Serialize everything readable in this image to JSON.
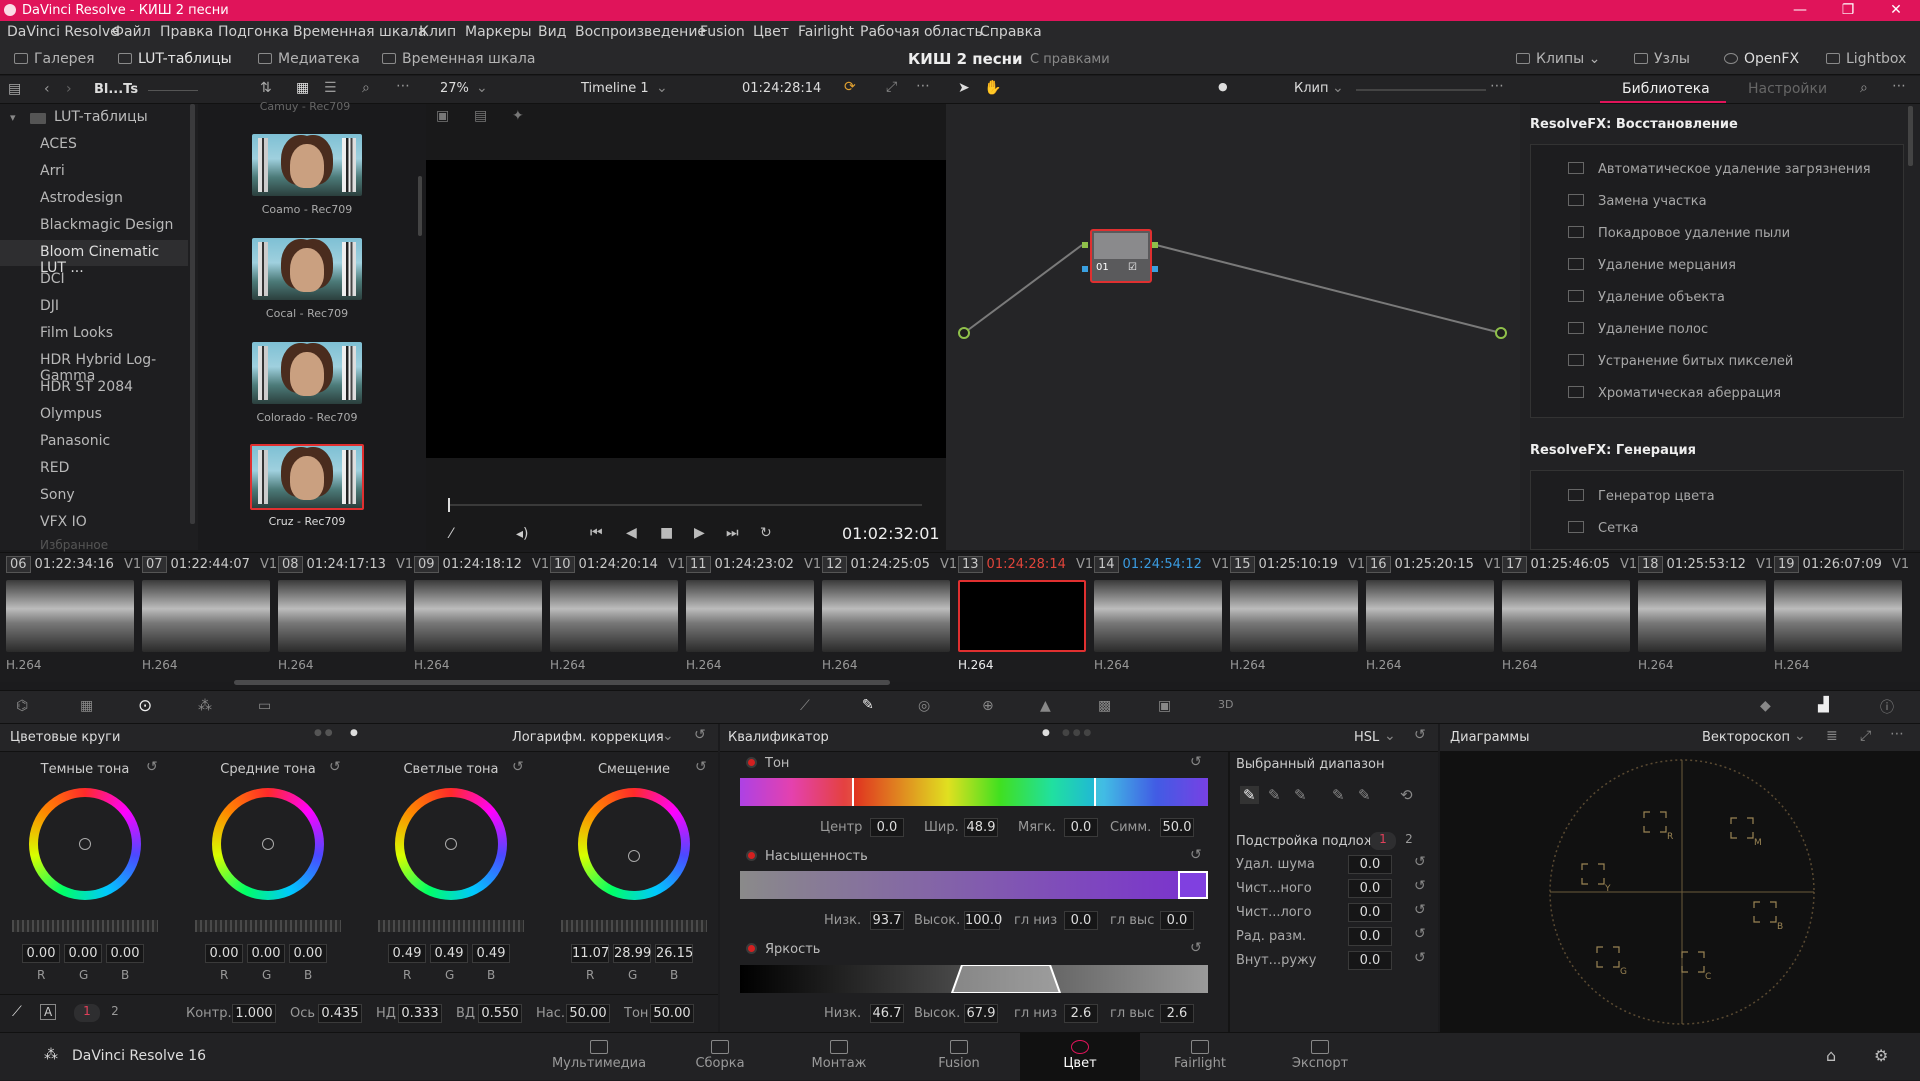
{
  "title": "DaVinci Resolve - КИШ 2 песни",
  "window_controls": [
    "—",
    "❐",
    "✕"
  ],
  "menu": [
    "DaVinci Resolve",
    "Файл",
    "Правка",
    "Подгонка",
    "Временная шкала",
    "Клип",
    "Маркеры",
    "Вид",
    "Воспроизведение",
    "Fusion",
    "Цвет",
    "Fairlight",
    "Рабочая область",
    "Справка"
  ],
  "toolbar": {
    "gallery": "Галерея",
    "luts": "LUT-таблицы",
    "media": "Медиатека",
    "timeline": "Временная шкала",
    "project": "КИШ 2 песни",
    "edited": "С правками",
    "clips": "Клипы",
    "nodes": "Узлы",
    "openfx": "OpenFX",
    "lightbox": "Lightbox"
  },
  "lut_panel": {
    "crumb": "Bl...Ts",
    "root": "LUT-таблицы",
    "items": [
      "ACES",
      "Arri",
      "Astrodesign",
      "Blackmagic Design",
      "Bloom Cinematic LUT ...",
      "DCI",
      "DJI",
      "Film Looks",
      "HDR Hybrid Log-Gamma",
      "HDR ST 2084",
      "Olympus",
      "Panasonic",
      "RED",
      "Sony",
      "VFX IO"
    ],
    "faded": "Избранное",
    "selected_index": 4
  },
  "lut_thumbs": {
    "top_cut": "Camuy - Rec709",
    "labels": [
      "Coamo - Rec709",
      "Cocal - Rec709",
      "Colorado - Rec709",
      "Cruz - Rec709"
    ],
    "selected_index": 3
  },
  "viewer": {
    "zoom": "27%",
    "timeline": "Timeline 1",
    "tc": "01:24:28:14",
    "playhead_tc": "01:02:32:01"
  },
  "node_editor": {
    "mode": "Клип",
    "node_label": "01"
  },
  "library": {
    "tab_active": "Библиотека",
    "tab_inactive": "Настройки",
    "group1": "ResolveFX: Восстановление",
    "items1": [
      "Автоматическое удаление загрязнения",
      "Замена участка",
      "Покадровое удаление пыли",
      "Удаление мерцания",
      "Удаление объекта",
      "Удаление полос",
      "Устранение битых пикселей",
      "Хроматическая аберрация"
    ],
    "group2": "ResolveFX: Генерация",
    "items2": [
      "Генератор цвета",
      "Сетка"
    ]
  },
  "clips": [
    {
      "n": "06",
      "tc": "01:22:34:16",
      "tr": "V1",
      "codec": "H.264"
    },
    {
      "n": "07",
      "tc": "01:22:44:07",
      "tr": "V1",
      "codec": "H.264"
    },
    {
      "n": "08",
      "tc": "01:24:17:13",
      "tr": "V1",
      "codec": "H.264"
    },
    {
      "n": "09",
      "tc": "01:24:18:12",
      "tr": "V1",
      "codec": "H.264"
    },
    {
      "n": "10",
      "tc": "01:24:20:14",
      "tr": "V1",
      "codec": "H.264"
    },
    {
      "n": "11",
      "tc": "01:24:23:02",
      "tr": "V1",
      "codec": "H.264"
    },
    {
      "n": "12",
      "tc": "01:24:25:05",
      "tr": "V1",
      "codec": "H.264"
    },
    {
      "n": "13",
      "tc": "01:24:28:14",
      "tr": "V1",
      "codec": "H.264"
    },
    {
      "n": "14",
      "tc": "01:24:54:12",
      "tr": "V1",
      "codec": "H.264"
    },
    {
      "n": "15",
      "tc": "01:25:10:19",
      "tr": "V1",
      "codec": "H.264"
    },
    {
      "n": "16",
      "tc": "01:25:20:15",
      "tr": "V1",
      "codec": "H.264"
    },
    {
      "n": "17",
      "tc": "01:25:46:05",
      "tr": "V1",
      "codec": "H.264"
    },
    {
      "n": "18",
      "tc": "01:25:53:12",
      "tr": "V1",
      "codec": "H.264"
    },
    {
      "n": "19",
      "tc": "01:26:07:09",
      "tr": "V1",
      "codec": "H.264"
    }
  ],
  "clip_selected_index": 7,
  "clip_tc_colors": {
    "selected": "#e0443a",
    "next": "#3a9be0"
  },
  "color_wheels": {
    "title": "Цветовые круги",
    "mode": "Логарифм. коррекция",
    "wheels": [
      {
        "label": "Темные тона",
        "r": "0.00",
        "g": "0.00",
        "b": "0.00"
      },
      {
        "label": "Средние тона",
        "r": "0.00",
        "g": "0.00",
        "b": "0.00"
      },
      {
        "label": "Светлые тона",
        "r": "0.49",
        "g": "0.49",
        "b": "0.49"
      },
      {
        "label": "Смещение",
        "r": "11.07",
        "g": "28.99",
        "b": "26.15"
      }
    ],
    "rgb": [
      "R",
      "G",
      "B"
    ],
    "page1": "1",
    "page2": "2",
    "bottom": {
      "contrast_l": "Контр.",
      "contrast": "1.000",
      "pivot_l": "Ось",
      "pivot": "0.435",
      "low_l": "НД",
      "low": "0.333",
      "high_l": "ВД",
      "high": "0.550",
      "sat_l": "Нас.",
      "sat": "50.00",
      "hue_l": "Тон",
      "hue": "50.00"
    }
  },
  "qualifier": {
    "title": "Квалификатор",
    "mode": "HSL",
    "hue": {
      "label": "Тон",
      "center_l": "Центр",
      "center": "0.0",
      "width_l": "Шир.",
      "width": "48.9",
      "soft_l": "Мягк.",
      "soft": "0.0",
      "sym_l": "Симм.",
      "sym": "50.0"
    },
    "sat": {
      "label": "Насыщенность",
      "low_l": "Низк.",
      "low": "93.7",
      "high_l": "Высок.",
      "high": "100.0",
      "lsoft_l": "гл низ",
      "lsoft": "0.0",
      "hsoft_l": "гл выс",
      "hsoft": "0.0"
    },
    "lum": {
      "label": "Яркость",
      "low_l": "Низк.",
      "low": "46.7",
      "high_l": "Высок.",
      "high": "67.9",
      "lsoft_l": "гл низ",
      "lsoft": "2.6",
      "hsoft_l": "гл выс",
      "hsoft": "2.6"
    }
  },
  "range": {
    "title": "Выбранный диапазон",
    "matte_title": "Подстройка подложки",
    "tab1": "1",
    "tab2": "2",
    "rows": [
      {
        "l": "Удал. шума",
        "v": "0.0"
      },
      {
        "l": "Чист...ного",
        "v": "0.0"
      },
      {
        "l": "Чист...лого",
        "v": "0.0"
      },
      {
        "l": "Рад. разм.",
        "v": "0.0"
      },
      {
        "l": "Внут...ружу",
        "v": "0.0"
      }
    ]
  },
  "scopes": {
    "title": "Диаграммы",
    "mode": "Вектороскоп",
    "targets": [
      "R",
      "M",
      "Y",
      "B",
      "G",
      "C"
    ]
  },
  "footer": {
    "app": "DaVinci Resolve 16",
    "pages": [
      "Мультимедиа",
      "Сборка",
      "Монтаж",
      "Fusion",
      "Цвет",
      "Fairlight",
      "Экспорт"
    ],
    "active_index": 4
  },
  "colors": {
    "accent_pink": "#e0145a",
    "selection_red": "#e03030",
    "active_tab": "#e0145a"
  }
}
